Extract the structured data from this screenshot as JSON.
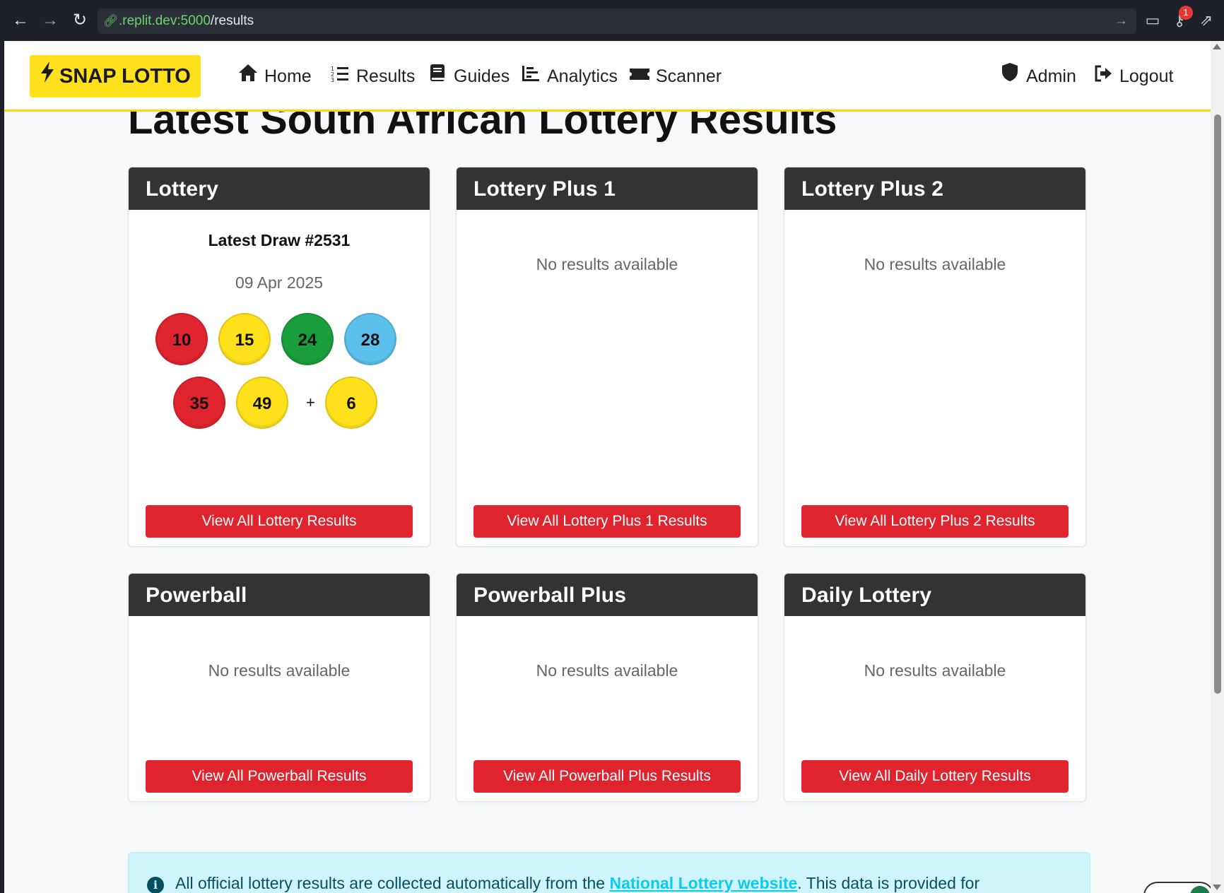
{
  "browser": {
    "url_host": ".replit.dev:5000",
    "url_path": "/results",
    "notification_count": "1"
  },
  "navbar": {
    "brand": "SNAP LOTTO",
    "items": [
      {
        "label": "Home",
        "icon": "home-icon"
      },
      {
        "label": "Results",
        "icon": "list-ol-icon"
      },
      {
        "label": "Guides",
        "icon": "book-icon"
      },
      {
        "label": "Analytics",
        "icon": "chart-bar-icon"
      },
      {
        "label": "Scanner",
        "icon": "ticket-icon"
      }
    ],
    "right_items": [
      {
        "label": "Admin",
        "icon": "shield-icon"
      },
      {
        "label": "Logout",
        "icon": "sign-out-icon"
      }
    ]
  },
  "page": {
    "title": "Latest South African Lottery Results"
  },
  "cards": [
    {
      "title": "Lottery",
      "latest_draw": "Latest Draw #2531",
      "date": "09 Apr 2025",
      "balls_row1": [
        "10",
        "15",
        "24",
        "28"
      ],
      "balls_row2": [
        "35",
        "49"
      ],
      "plus": "+",
      "bonus": "6",
      "button": "View All Lottery Results"
    },
    {
      "title": "Lottery Plus 1",
      "empty": "No results available",
      "button": "View All Lottery Plus 1 Results"
    },
    {
      "title": "Lottery Plus 2",
      "empty": "No results available",
      "button": "View All Lottery Plus 2 Results"
    },
    {
      "title": "Powerball",
      "empty": "No results available",
      "button": "View All Powerball Results"
    },
    {
      "title": "Powerball Plus",
      "empty": "No results available",
      "button": "View All Powerball Plus Results"
    },
    {
      "title": "Daily Lottery",
      "empty": "No results available",
      "button": "View All Daily Lottery Results"
    }
  ],
  "alert": {
    "before": "All official lottery results are collected automatically from the ",
    "link": "National Lottery website",
    "after": ". This data is provided for"
  },
  "colors": {
    "brand_yellow": "#ffe11b",
    "button_red": "#e0242e",
    "card_header": "#333333",
    "ball_red": "#e0242e",
    "ball_yellow": "#ffe11b",
    "ball_green": "#1a9e3c",
    "ball_blue": "#5bc0eb"
  }
}
